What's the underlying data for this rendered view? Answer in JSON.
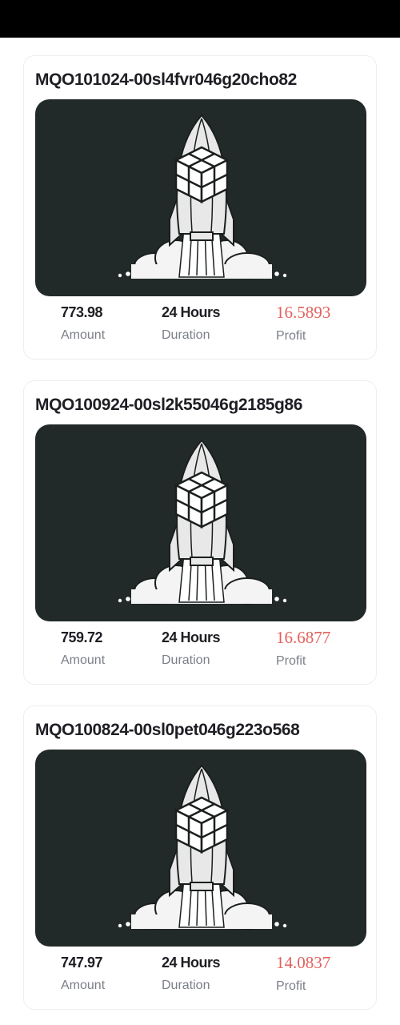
{
  "orders": [
    {
      "id": "MQO101024-00sl4fvr046g20cho82",
      "amount": "773.98",
      "amount_label": "Amount",
      "duration": "24 Hours",
      "duration_label": "Duration",
      "profit": "16.5893",
      "profit_label": "Profit"
    },
    {
      "id": "MQO100924-00sl2k55046g2185g86",
      "amount": "759.72",
      "amount_label": "Amount",
      "duration": "24 Hours",
      "duration_label": "Duration",
      "profit": "16.6877",
      "profit_label": "Profit"
    },
    {
      "id": "MQO100824-00sl0pet046g223o568",
      "amount": "747.97",
      "amount_label": "Amount",
      "duration": "24 Hours",
      "duration_label": "Duration",
      "profit": "14.0837",
      "profit_label": "Profit"
    }
  ],
  "colors": {
    "banner_bg": "#222a29",
    "profit": "#e2615c",
    "title": "#1e1e24",
    "label": "#7b7f88"
  },
  "icons": {
    "banner_art": "rocket-icon"
  }
}
